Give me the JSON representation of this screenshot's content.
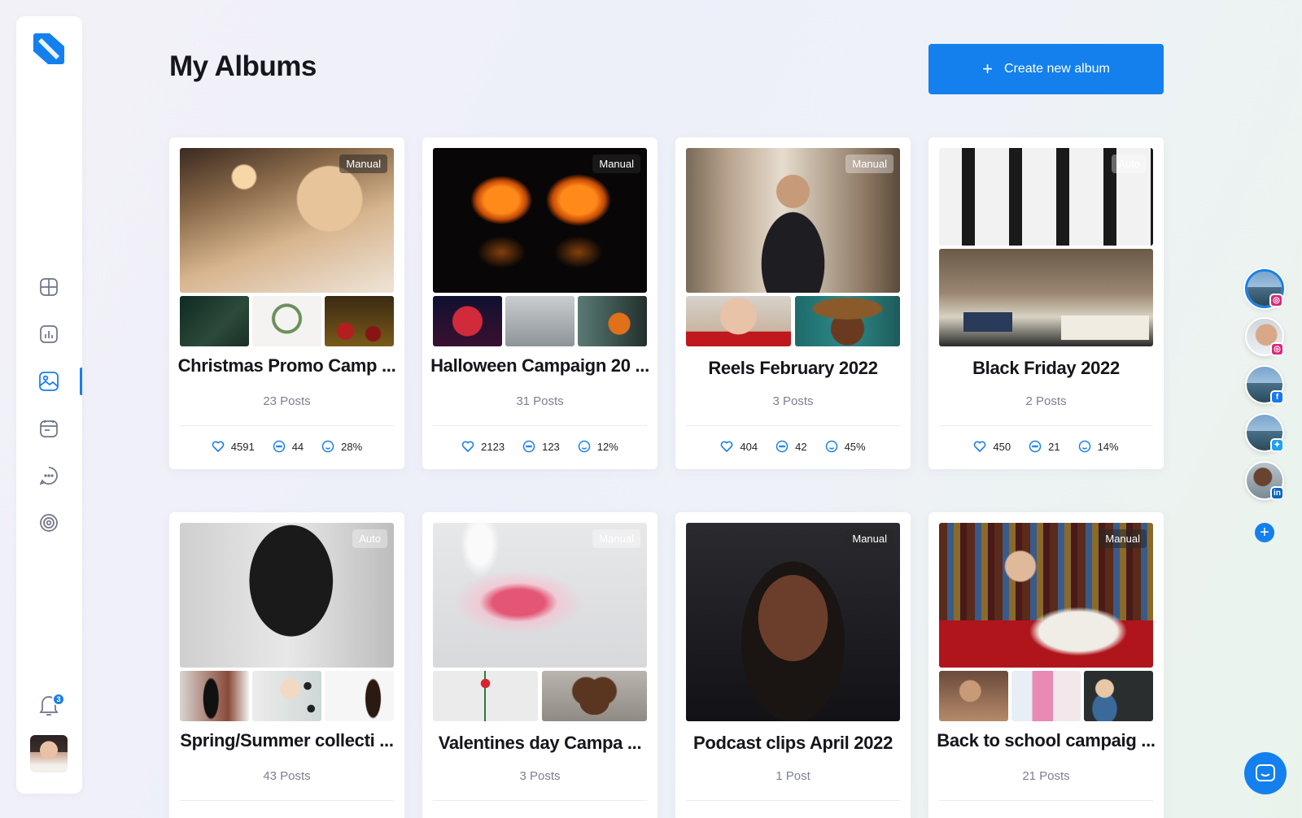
{
  "page": {
    "title": "My Albums"
  },
  "header": {
    "create_label": "Create new album",
    "create_icon": "plus-icon"
  },
  "sidebar": {
    "items": [
      {
        "name": "dashboard",
        "icon": "layout-icon"
      },
      {
        "name": "analytics",
        "icon": "chart-icon"
      },
      {
        "name": "albums",
        "icon": "image-icon",
        "active": true
      },
      {
        "name": "calendar",
        "icon": "calendar-icon"
      },
      {
        "name": "messages",
        "icon": "chat-icon"
      },
      {
        "name": "targets",
        "icon": "target-icon"
      }
    ],
    "notifications": {
      "count": "3",
      "icon": "bell-icon"
    }
  },
  "albums": [
    {
      "title": "Christmas Promo Camp ...",
      "posts": "23 Posts",
      "mode": "Manual",
      "likes": "4591",
      "comments": "44",
      "rate": "28%"
    },
    {
      "title": "Halloween Campaign 20 ...",
      "posts": "31 Posts",
      "mode": "Manual",
      "likes": "2123",
      "comments": "123",
      "rate": "12%"
    },
    {
      "title": "Reels February 2022",
      "posts": "3 Posts",
      "mode": "Manual",
      "likes": "404",
      "comments": "42",
      "rate": "45%"
    },
    {
      "title": "Black Friday 2022",
      "posts": "2 Posts",
      "mode": "Auto",
      "likes": "450",
      "comments": "21",
      "rate": "14%"
    },
    {
      "title": "Spring/Summer collecti ...",
      "posts": "43 Posts",
      "mode": "Auto"
    },
    {
      "title": "Valentines day Campa ...",
      "posts": "3 Posts",
      "mode": "Manual"
    },
    {
      "title": "Podcast clips April 2022",
      "posts": "1 Post",
      "mode": "Manual"
    },
    {
      "title": "Back to school campaig ...",
      "posts": "21 Posts",
      "mode": "Manual"
    }
  ],
  "accounts": [
    {
      "network": "instagram",
      "active": true
    },
    {
      "network": "instagram"
    },
    {
      "network": "facebook"
    },
    {
      "network": "twitter"
    },
    {
      "network": "linkedin"
    }
  ],
  "colors": {
    "accent": "#1380ee",
    "instagram": "#d6297a",
    "facebook": "#1877f2",
    "twitter": "#1da1f2",
    "linkedin": "#0a66c2"
  }
}
